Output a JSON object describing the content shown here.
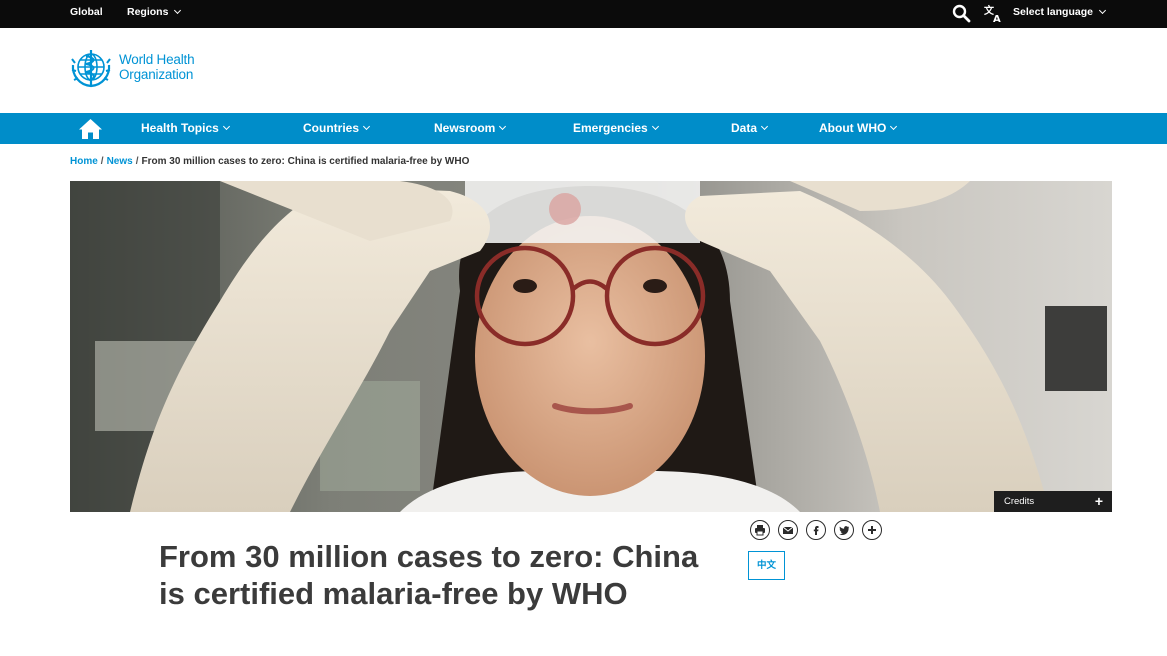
{
  "topbar": {
    "global_label": "Global",
    "regions_label": "Regions",
    "select_language_label": "Select language",
    "icons": [
      "search-icon",
      "translate-icon",
      "chevron-down-icon"
    ]
  },
  "header": {
    "logo_line1": "World Health",
    "logo_line2": "Organization"
  },
  "nav": {
    "items": [
      {
        "label": "Health Topics"
      },
      {
        "label": "Countries"
      },
      {
        "label": "Newsroom"
      },
      {
        "label": "Emergencies"
      },
      {
        "label": "Data"
      },
      {
        "label": "About WHO"
      }
    ]
  },
  "breadcrumb": {
    "home": "Home",
    "news": "News",
    "separator": "/",
    "current": "From 30 million cases to zero: China is certified malaria-free by WHO"
  },
  "hero": {
    "credits_label": "Credits",
    "credits_expand": "+"
  },
  "share": {
    "icons": [
      "print-icon",
      "email-icon",
      "facebook-icon",
      "twitter-icon",
      "plus-icon"
    ],
    "language_button": "中文"
  },
  "article": {
    "title": "From 30 million cases to zero: China is certified malaria-free by WHO"
  },
  "colors": {
    "topbar_bg": "#0b0b0b",
    "nav_bg": "#008dc9",
    "brand_blue": "#0093d5",
    "title_text": "#3b3b3b"
  }
}
